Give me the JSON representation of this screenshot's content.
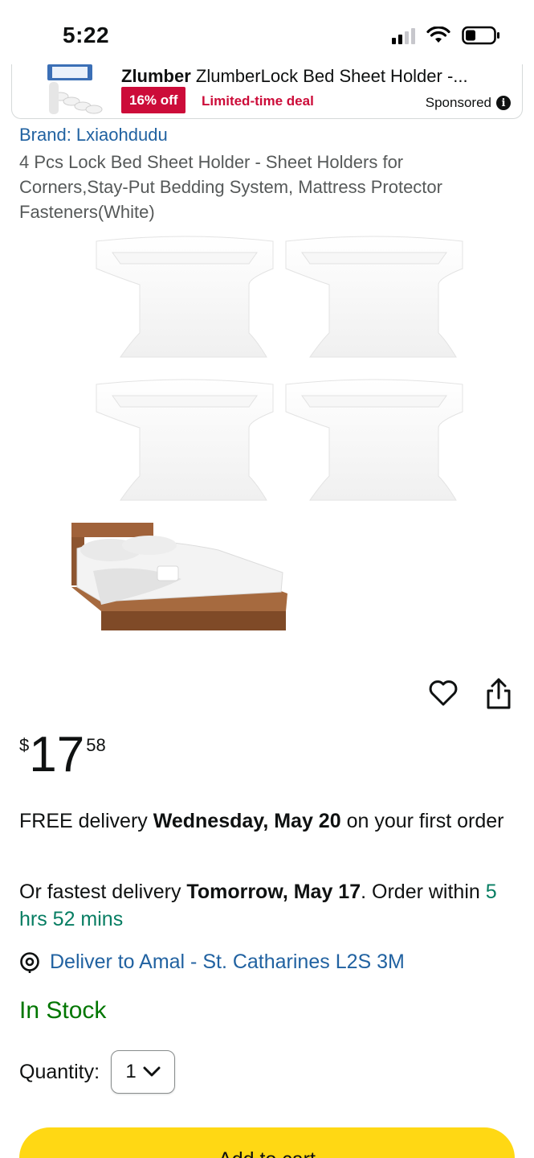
{
  "status_bar": {
    "time": "5:22"
  },
  "ad": {
    "brand": "Zlumber",
    "title": "ZlumberLock Bed Sheet Holder -...",
    "discount": "16% off",
    "deal": "Limited-time deal",
    "sponsored": "Sponsored",
    "info": "i"
  },
  "product": {
    "brand": "Brand: Lxiaohdudu",
    "title": "4 Pcs Lock Bed Sheet Holder - Sheet Holders for Corners,Stay-Put Bedding System, Mattress Protector Fasteners(White)"
  },
  "price": {
    "symbol": "$",
    "whole": "17",
    "fraction": "58"
  },
  "delivery": {
    "free_prefix": "FREE delivery ",
    "free_date": "Wednesday, May 20",
    "free_suffix": " on your first order",
    "fast_prefix": "Or fastest delivery ",
    "fast_date": "Tomorrow, May 17",
    "fast_mid": ". Order within ",
    "countdown": "5 hrs 52 mins",
    "deliver_to": "Deliver to Amal - St. Catharines L2S 3M"
  },
  "stock": "In Stock",
  "quantity": {
    "label": "Quantity:",
    "value": "1"
  },
  "cart": {
    "label": "Add to cart"
  },
  "colors": {
    "link": "#2162a1",
    "deal_red": "#cc0c39",
    "stock_green": "#007600",
    "cart_yellow": "#ffd814"
  }
}
